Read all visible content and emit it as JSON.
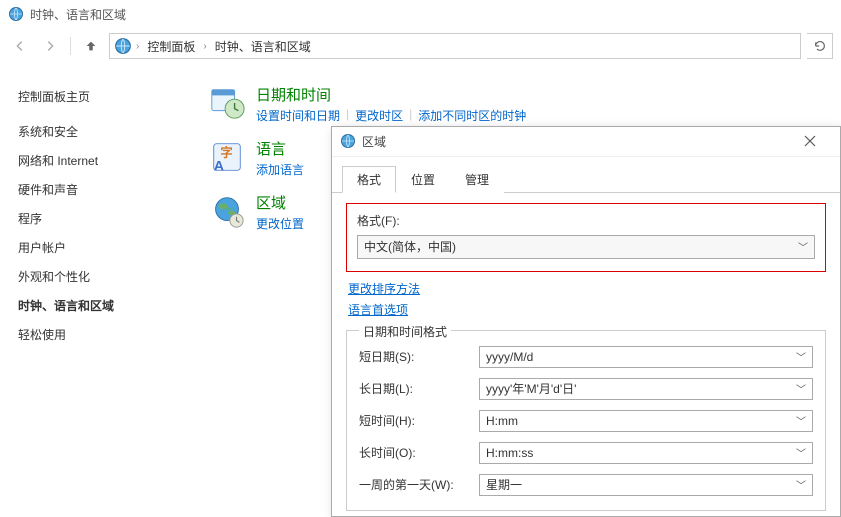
{
  "window": {
    "title": "时钟、语言和区域"
  },
  "breadcrumb": {
    "item1": "控制面板",
    "item2": "时钟、语言和区域"
  },
  "sidebar": {
    "home": "控制面板主页",
    "items": [
      "系统和安全",
      "网络和 Internet",
      "硬件和声音",
      "程序",
      "用户帐户",
      "外观和个性化",
      "时钟、语言和区域",
      "轻松使用"
    ],
    "active_index": 6
  },
  "categories": {
    "datetime": {
      "title": "日期和时间",
      "links": [
        "设置时间和日期",
        "更改时区",
        "添加不同时区的时钟"
      ]
    },
    "language": {
      "title": "语言",
      "links": [
        "添加语言"
      ]
    },
    "region": {
      "title": "区域",
      "links": [
        "更改位置"
      ]
    }
  },
  "dialog": {
    "title": "区域",
    "tabs": [
      "格式",
      "位置",
      "管理"
    ],
    "active_tab": 0,
    "format_label": "格式(F):",
    "format_value": "中文(简体，中国)",
    "change_sort_link": "更改排序方法",
    "lang_pref_link": "语言首选项",
    "fieldset_legend": "日期和时间格式",
    "rows": [
      {
        "label": "短日期(S):",
        "value": "yyyy/M/d"
      },
      {
        "label": "长日期(L):",
        "value": "yyyy'年'M'月'd'日'"
      },
      {
        "label": "短时间(H):",
        "value": "H:mm"
      },
      {
        "label": "长时间(O):",
        "value": "H:mm:ss"
      },
      {
        "label": "一周的第一天(W):",
        "value": "星期一"
      }
    ]
  }
}
